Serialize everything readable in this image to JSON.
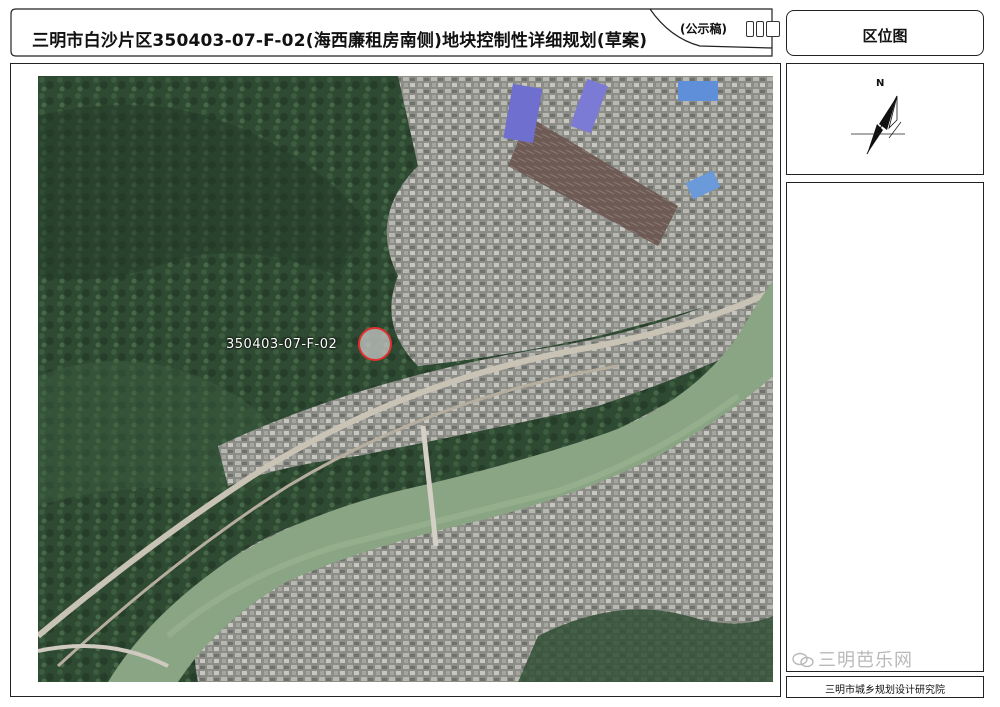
{
  "header": {
    "title": "三明市白沙片区350403-07-F-02(海西廉租房南侧)地块控制性详细规划(草案)",
    "draft_tag": "(公示稿)"
  },
  "location_panel": {
    "title": "区位图",
    "north_label": "N"
  },
  "map": {
    "parcel_label": "350403-07-F-02"
  },
  "footer": {
    "institute": "三明市城乡规划设计研究院",
    "watermark": "三明芭乐网"
  },
  "colors": {
    "river": "#8aa583",
    "forest": "#2f4a33",
    "urban": "#9a9a94",
    "parcel_circle": "#e0312e"
  }
}
